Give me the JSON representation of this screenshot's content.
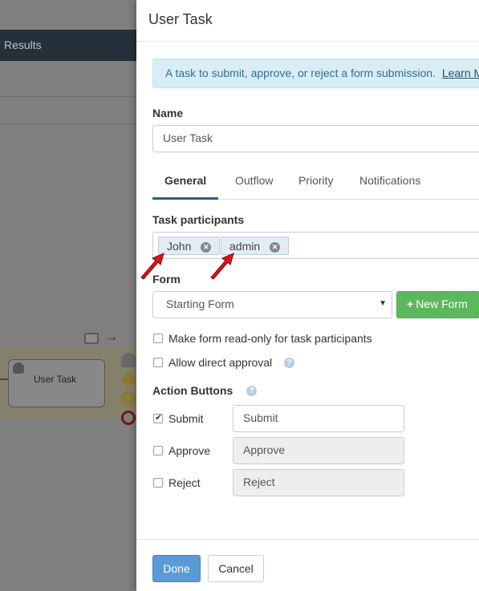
{
  "background": {
    "topbar_label": "Results",
    "task_label": "User Task"
  },
  "panel": {
    "title": "User Task",
    "info_text": "A task to submit, approve, or reject a form submission.",
    "info_link": "Learn M",
    "name_label": "Name",
    "name_value": "User Task",
    "tabs": [
      {
        "label": "General",
        "active": true
      },
      {
        "label": "Outflow",
        "active": false
      },
      {
        "label": "Priority",
        "active": false
      },
      {
        "label": "Notifications",
        "active": false
      }
    ],
    "participants_label": "Task participants",
    "participants": [
      "John",
      "admin"
    ],
    "form_label": "Form",
    "form_selected": "Starting Form",
    "new_form_label": "New Form",
    "readonly_label": "Make form read-only for task participants",
    "direct_approval_label": "Allow direct approval",
    "action_buttons_label": "Action Buttons",
    "actions": [
      {
        "label": "Submit",
        "checked": true,
        "value": "Submit"
      },
      {
        "label": "Approve",
        "checked": false,
        "value": "Approve"
      },
      {
        "label": "Reject",
        "checked": false,
        "value": "Reject"
      }
    ],
    "done_label": "Done",
    "cancel_label": "Cancel"
  },
  "colors": {
    "accent_blue": "#5b9bd5",
    "success_green": "#5cb85c",
    "info_bg": "#d9edf7",
    "arrow_red": "#d9141c"
  },
  "icons": [
    "person-icon",
    "remove-tag-icon",
    "help-icon",
    "plus-icon",
    "caret-down-icon",
    "red-pointer-arrow"
  ]
}
